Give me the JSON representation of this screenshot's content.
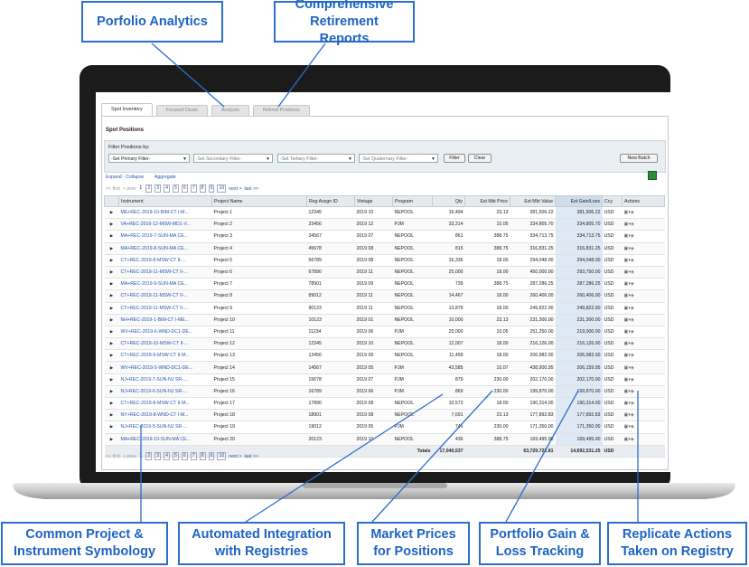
{
  "callouts": {
    "analytics": "Porfolio Analytics",
    "reports": "Comprehensive Retirement Reports",
    "symbology": "Common Project & Instrument Symbology",
    "integration": "Automated Integration with Registries",
    "prices": "Market Prices for Positions",
    "gainloss": "Portfolio Gain & Loss Tracking",
    "actions": "Replicate Actions Taken on Registry"
  },
  "tabs": [
    "Spot Inventory",
    "Forward Deals",
    "Analysis",
    "Retired Positions"
  ],
  "panel_title": "Spot Positions",
  "filters": {
    "label": "Filter Positions by:",
    "primary": "-Set Primary Filter-",
    "secondary": "-Set Secondary Filter-",
    "tertiary": "-Set Tertiary Filter-",
    "quaternary": "-Set Quaternary Filter-",
    "filter_btn": "Filter",
    "clear_btn": "Clear",
    "new_batch_btn": "New Batch"
  },
  "links": {
    "expand": "Expand",
    "sep": " - ",
    "collapse": "Collapse",
    "aggregate": "Aggregate"
  },
  "pager": {
    "first": "<< first",
    "prev": "< prev",
    "pages": [
      "1",
      "2",
      "3",
      "4",
      "5",
      "6",
      "7",
      "8",
      "9",
      "10"
    ],
    "next": "next >",
    "last": "last >>"
  },
  "columns": [
    "Instrument",
    "Project Name",
    "Reg Assgn ID",
    "Vintage",
    "Program",
    "Qty",
    "Est Mkt Price",
    "Est Mkt Value",
    "Est Gain/Loss",
    "Ccy",
    "Actions"
  ],
  "rows": [
    [
      "ME+REC-2019-10-BIM-CT I-M...",
      "Project 1",
      "12345",
      "2019 10",
      "NEPOOL",
      "16,494",
      "23.13",
      "381,506.22",
      "381,506.22",
      "USD"
    ],
    [
      "VA+REC-2019-12-MSW-MD1-V...",
      "Project 2",
      "23456",
      "2019 12",
      "PJM",
      "33,314",
      "10.05",
      "334,805.70",
      "334,805.70",
      "USD"
    ],
    [
      "MA+REC-2019-7-SUN-MA CE...",
      "Project 3",
      "34567",
      "2019 07",
      "NEPOOL",
      "861",
      "388.75",
      "334,713.75",
      "334,713.75",
      "USD"
    ],
    [
      "MA+REC-2019-8-SUN-MA CE...",
      "Project 4",
      "45678",
      "2019 08",
      "NEPOOL",
      "815",
      "388.75",
      "316,831.25",
      "316,831.25",
      "USD"
    ],
    [
      "CT+REC-2019-8-MSW-CT II-...",
      "Project 5",
      "56789",
      "2019 08",
      "NEPOOL",
      "16,336",
      "18.00",
      "294,048.00",
      "294,048.00",
      "USD"
    ],
    [
      "CT+REC-2019-11-MSW-CT II-...",
      "Project 6",
      "67890",
      "2019 11",
      "NEPOOL",
      "25,000",
      "18.00",
      "450,000.00",
      "293,750.00",
      "USD"
    ],
    [
      "MA+REC-2019-9-SUN-MA CE...",
      "Project 7",
      "78901",
      "2019 09",
      "NEPOOL",
      "739",
      "388.75",
      "287,286.25",
      "287,286.25",
      "USD"
    ],
    [
      "CT+REC-2019-11-MSW-CT II-...",
      "Project 8",
      "89012",
      "2019 11",
      "NEPOOL",
      "14,467",
      "18.00",
      "260,406.00",
      "260,406.00",
      "USD"
    ],
    [
      "CT+REC-2019-11-MSW-CT II-...",
      "Project 9",
      "90123",
      "2019 11",
      "NEPOOL",
      "13,879",
      "18.00",
      "249,822.00",
      "249,822.00",
      "USD"
    ],
    [
      "NH+REC-2019-1-BIM-CT I-ME...",
      "Project 10",
      "10123",
      "2019 01",
      "NEPOOL",
      "10,000",
      "23.13",
      "231,300.00",
      "231,300.00",
      "USD"
    ],
    [
      "WV+REC-2019-6-WND-DC1-DE...",
      "Project 11",
      "11234",
      "2019 06",
      "PJM",
      "25,000",
      "10.05",
      "251,250.00",
      "219,000.00",
      "USD"
    ],
    [
      "CT+REC-2019-10-MSW-CT II-...",
      "Project 12",
      "12345",
      "2019 10",
      "NEPOOL",
      "12,007",
      "18.00",
      "216,126.00",
      "216,126.00",
      "USD"
    ],
    [
      "CT+REC-2019-9-MSW-CT II-M...",
      "Project 13",
      "13456",
      "2019 09",
      "NEPOOL",
      "11,499",
      "18.00",
      "206,982.00",
      "206,982.00",
      "USD"
    ],
    [
      "WV+REC-2019-5-WND-DC1-DE...",
      "Project 14",
      "14567",
      "2019 05",
      "PJM",
      "43,585",
      "10.07",
      "438,900.95",
      "206,159.95",
      "USD"
    ],
    [
      "NJ+REC-2019-7-SUN-NJ SR-...",
      "Project 15",
      "15678",
      "2019 07",
      "PJM",
      "879",
      "230.00",
      "202,170.00",
      "202,170.00",
      "USD"
    ],
    [
      "NJ+REC-2019-6-SUN-NJ SR-...",
      "Project 16",
      "16789",
      "2019 06",
      "PJM",
      "869",
      "230.00",
      "199,870.00",
      "199,870.00",
      "USD"
    ],
    [
      "CT+REC-2019-8-MSW-CT II-M...",
      "Project 17",
      "17890",
      "2019 08",
      "NEPOOL",
      "10,573",
      "18.00",
      "190,314.00",
      "190,314.00",
      "USD"
    ],
    [
      "NY+REC-2019-8-WND-CT I-M...",
      "Project 18",
      "18901",
      "2019 08",
      "NEPOOL",
      "7,691",
      "23.13",
      "177,892.83",
      "177,892.83",
      "USD"
    ],
    [
      "NJ+REC-2019-5-SUN-NJ SR-...",
      "Project 19",
      "19012",
      "2019 05",
      "PJM",
      "745",
      "230.00",
      "171,350.00",
      "171,350.00",
      "USD"
    ],
    [
      "MA+REC-2019-10-SUN-MA CE...",
      "Project 20",
      "20123",
      "2019 10",
      "NEPOOL",
      "436",
      "388.75",
      "169,495.00",
      "169,495.00",
      "USD"
    ]
  ],
  "totals": {
    "label": "Totals",
    "qty": "17,040,537",
    "value": "63,729,722.81",
    "gain": "14,692,531.25",
    "ccy": "USD"
  }
}
